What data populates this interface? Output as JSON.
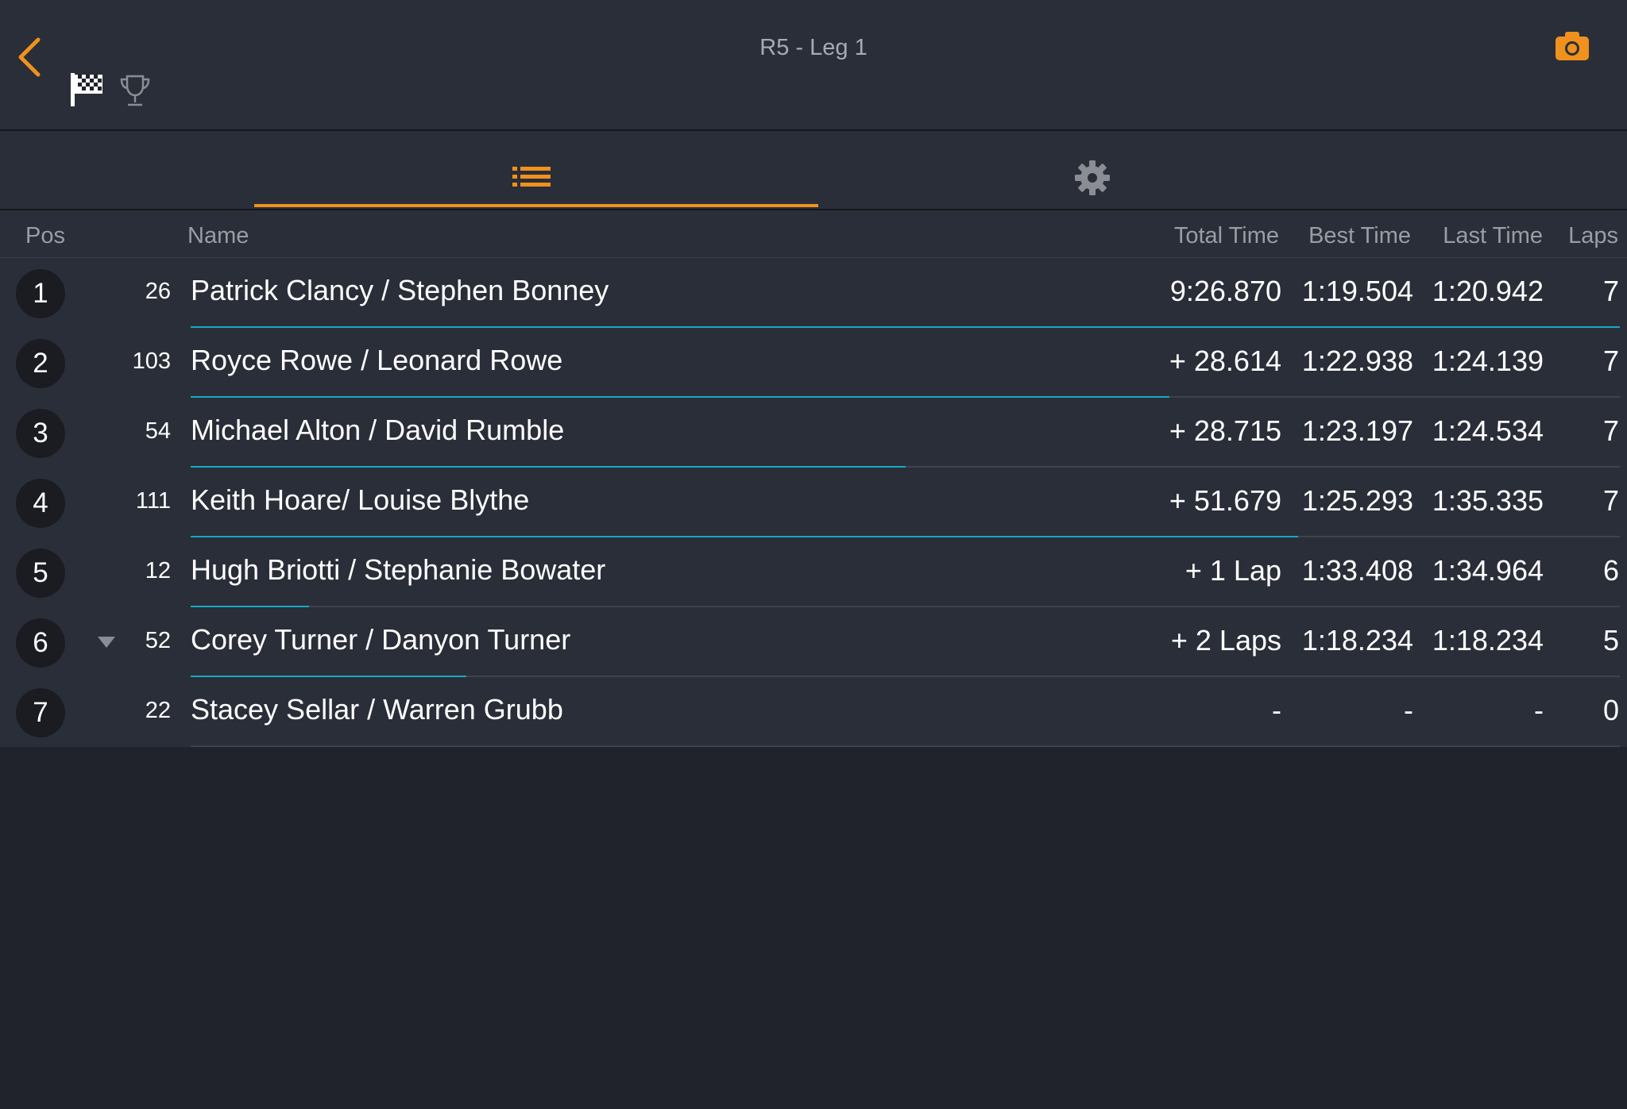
{
  "header": {
    "title": "R5 - Leg 1"
  },
  "columns": {
    "pos": "Pos",
    "name": "Name",
    "total": "Total Time",
    "best": "Best Time",
    "last": "Last Time",
    "laps": "Laps"
  },
  "colors": {
    "accent": "#f0911e",
    "progress": "#18a8c8"
  },
  "icons": {
    "back": "chevron-left-icon",
    "flag": "checkered-flag-icon",
    "trophy": "trophy-icon",
    "camera": "camera-icon",
    "list": "list-icon",
    "settings": "gear-icon"
  },
  "rows": [
    {
      "pos": "1",
      "num": "26",
      "name": "Patrick Clancy /  Stephen Bonney",
      "total": "9:26.870",
      "best": "1:19.504",
      "last": "1:20.942",
      "laps": "7",
      "trend": "",
      "progress": 1.0
    },
    {
      "pos": "2",
      "num": "103",
      "name": "Royce Rowe /  Leonard Rowe",
      "total": "+ 28.614",
      "best": "1:22.938",
      "last": "1:24.139",
      "laps": "7",
      "trend": "",
      "progress": 0.685
    },
    {
      "pos": "3",
      "num": "54",
      "name": "Michael Alton /  David Rumble",
      "total": "+ 28.715",
      "best": "1:23.197",
      "last": "1:24.534",
      "laps": "7",
      "trend": "",
      "progress": 0.5
    },
    {
      "pos": "4",
      "num": "111",
      "name": "Keith Hoare/ Louise Blythe",
      "total": "+ 51.679",
      "best": "1:25.293",
      "last": "1:35.335",
      "laps": "7",
      "trend": "",
      "progress": 0.775
    },
    {
      "pos": "5",
      "num": "12",
      "name": "Hugh Briotti /  Stephanie Bowater",
      "total": "+ 1 Lap",
      "best": "1:33.408",
      "last": "1:34.964",
      "laps": "6",
      "trend": "",
      "progress": 0.083
    },
    {
      "pos": "6",
      "num": "52",
      "name": "Corey Turner /  Danyon Turner",
      "total": "+ 2 Laps",
      "best": "1:18.234",
      "last": "1:18.234",
      "laps": "5",
      "trend": "down",
      "progress": 0.193
    },
    {
      "pos": "7",
      "num": "22",
      "name": "Stacey Sellar /  Warren Grubb",
      "total": "-",
      "best": "-",
      "last": "-",
      "laps": "0",
      "trend": "",
      "progress": 0
    }
  ]
}
